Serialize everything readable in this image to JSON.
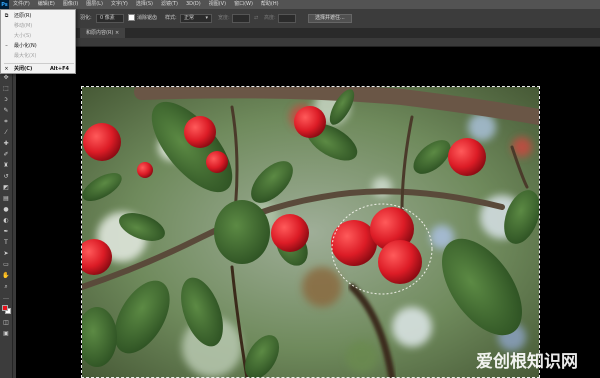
{
  "app": {
    "logo": "Ps"
  },
  "menubar": {
    "items": [
      "文件(F)",
      "编辑(E)",
      "图像(I)",
      "图层(L)",
      "文字(Y)",
      "选择(S)",
      "滤镜(T)",
      "3D(D)",
      "视图(V)",
      "窗口(W)",
      "帮助(H)"
    ]
  },
  "options_bar": {
    "feather_label": "羽化:",
    "feather_value": "0 像素",
    "antialias_label": "消除锯齿",
    "style_label": "样式:",
    "style_value": "正常",
    "width_label": "宽度:",
    "height_label": "高度:",
    "select_mask_button": "选择并遮住..."
  },
  "document_tab": {
    "label": "和原内容(R)"
  },
  "window_menu": {
    "items": [
      {
        "icon": "restore-icon",
        "label": "还原(R)",
        "shortcut": "",
        "disabled": false
      },
      {
        "icon": "",
        "label": "移动(M)",
        "shortcut": "",
        "disabled": true
      },
      {
        "icon": "",
        "label": "大小(S)",
        "shortcut": "",
        "disabled": true
      },
      {
        "icon": "minimize-icon",
        "label": "最小化(N)",
        "shortcut": "",
        "disabled": false
      },
      {
        "icon": "",
        "label": "最大化(X)",
        "shortcut": "",
        "disabled": true
      },
      {
        "icon": "close-icon",
        "label": "关闭(C)",
        "shortcut": "Alt+F4",
        "disabled": false
      }
    ]
  },
  "tools": [
    "move-icon",
    "marquee-icon",
    "lasso-icon",
    "quick-select-icon",
    "crop-icon",
    "eyedropper-icon",
    "healing-icon",
    "brush-icon",
    "clone-stamp-icon",
    "history-brush-icon",
    "eraser-icon",
    "gradient-icon",
    "blur-icon",
    "dodge-icon",
    "pen-icon",
    "type-icon",
    "path-select-icon",
    "shape-icon",
    "hand-icon",
    "zoom-icon",
    "more-icon"
  ],
  "colors": {
    "foreground": "#e8101a",
    "background": "#ffffff",
    "ui_dark": "#3c3c3c",
    "menubar": "#535353"
  },
  "watermark": {
    "text": "爱创根知识网"
  }
}
